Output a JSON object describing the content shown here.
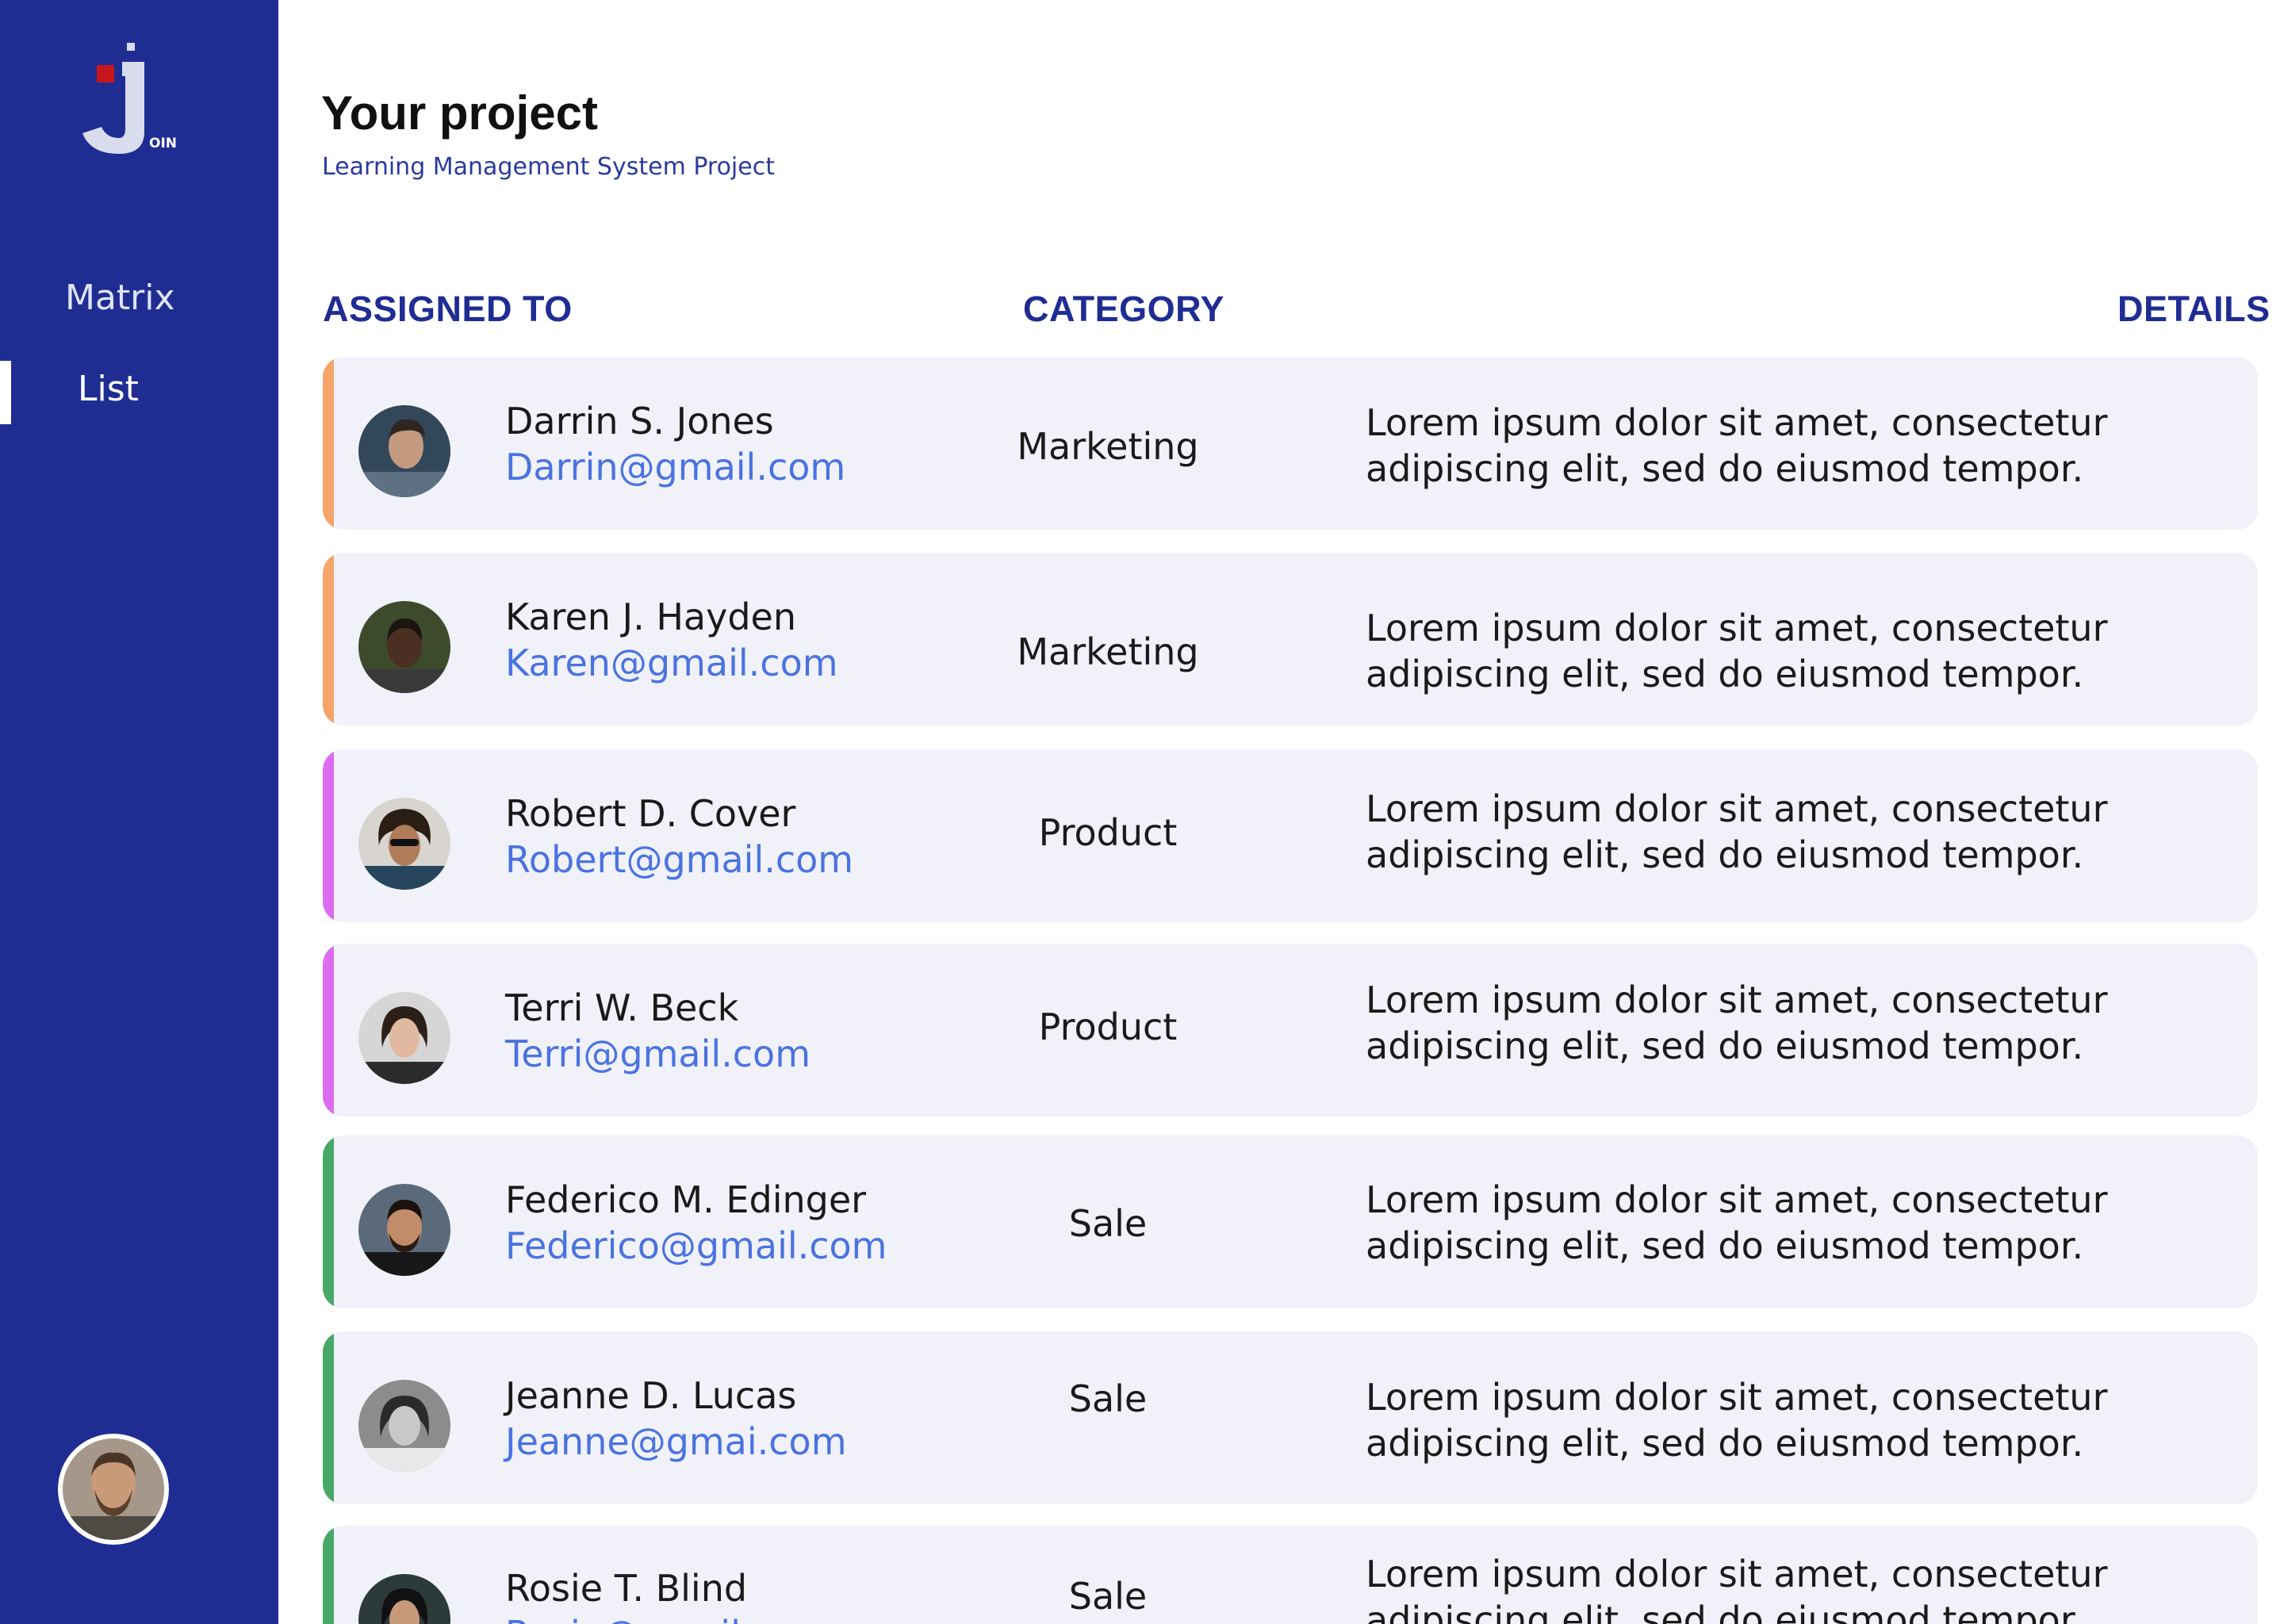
{
  "logo": {
    "text": "OIN"
  },
  "sidebar": {
    "items": [
      {
        "label": "Matrix",
        "active": false
      },
      {
        "label": "List",
        "active": true
      }
    ]
  },
  "header": {
    "title": "Your project",
    "subtitle": "Learning Management System Project"
  },
  "columns": {
    "assigned_to": "ASSIGNED TO",
    "category": "CATEGORY",
    "details": "DETAILS"
  },
  "colors": {
    "sidebar": "#1f2d93",
    "marketing": "#f6a56a",
    "product": "#dd6cf0",
    "sale": "#48a868",
    "email": "#4a73e0"
  },
  "rows": [
    {
      "name": "Darrin S. Jones",
      "email": "Darrin@gmail.com",
      "category": "Marketing",
      "details": "Lorem ipsum dolor sit amet, consectetur adipiscing elit, sed do eiusmod tempor."
    },
    {
      "name": "Karen J. Hayden",
      "email": "Karen@gmail.com",
      "category": "Marketing",
      "details": "Lorem ipsum dolor sit amet, consectetur adipiscing elit, sed do eiusmod tempor."
    },
    {
      "name": "Robert D. Cover",
      "email": "Robert@gmail.com",
      "category": "Product",
      "details": "Lorem ipsum dolor sit amet, consectetur adipiscing elit, sed do eiusmod tempor."
    },
    {
      "name": "Terri W. Beck",
      "email": "Terri@gmail.com",
      "category": "Product",
      "details": "Lorem ipsum dolor sit amet, consectetur adipiscing elit, sed do eiusmod tempor."
    },
    {
      "name": "Federico M. Edinger",
      "email": "Federico@gmail.com",
      "category": "Sale",
      "details": "Lorem ipsum dolor sit amet, consectetur adipiscing elit, sed do eiusmod tempor."
    },
    {
      "name": "Jeanne D. Lucas",
      "email": "Jeanne@gmai.com",
      "category": "Sale",
      "details": "Lorem ipsum dolor sit amet, consectetur adipiscing elit, sed do eiusmod tempor."
    },
    {
      "name": "Rosie T. Blind",
      "email": "Rosie@gmail.com",
      "category": "Sale",
      "details": "Lorem ipsum dolor sit amet, consectetur adipiscing elit, sed do eiusmod tempor."
    }
  ]
}
